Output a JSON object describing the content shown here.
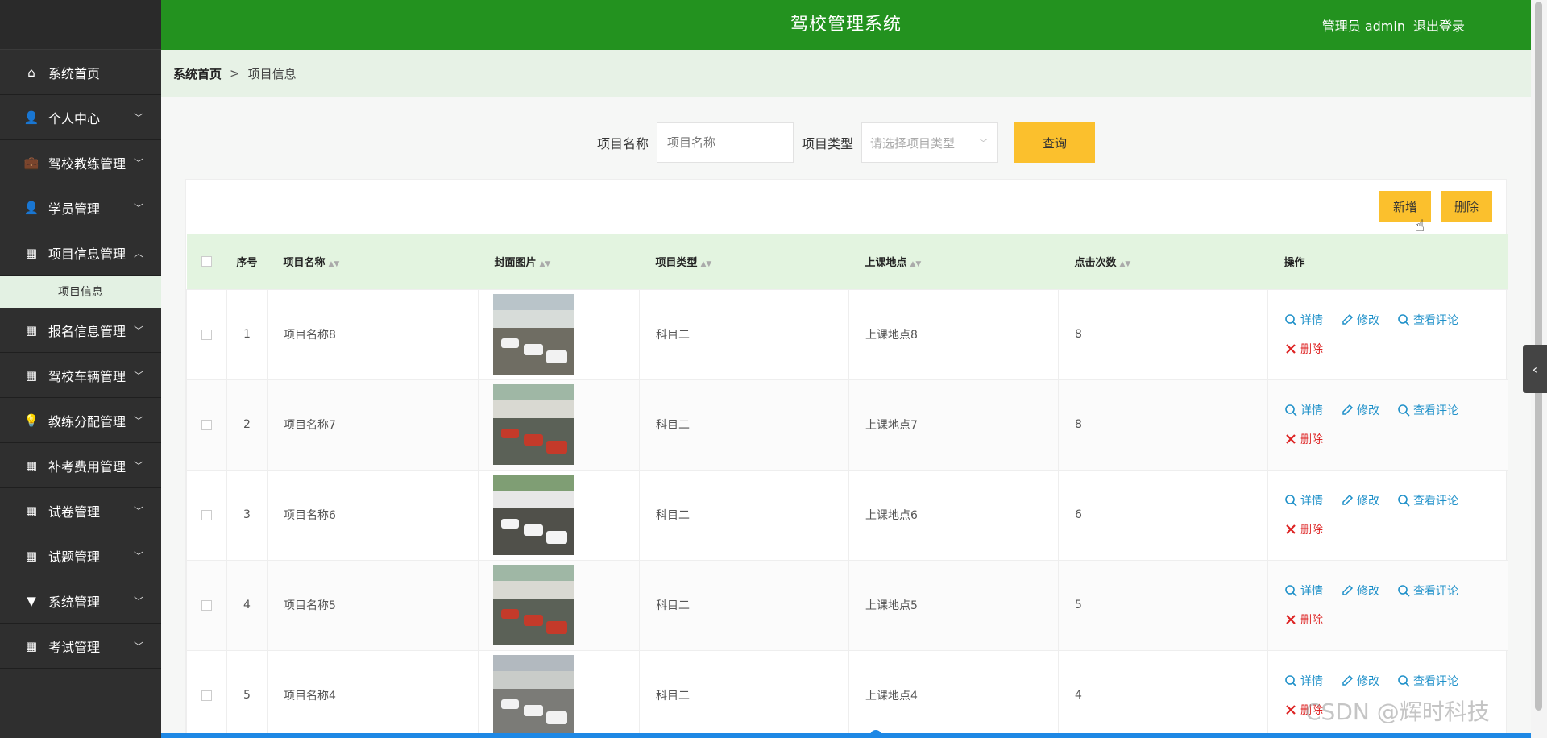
{
  "header": {
    "title": "驾校管理系统",
    "user": "管理员 admin",
    "logout": "退出登录"
  },
  "sidebar": {
    "items": [
      {
        "label": "系统首页",
        "icon": "home-icon",
        "glyph": "⌂",
        "chevron": ""
      },
      {
        "label": "个人中心",
        "icon": "user-icon",
        "glyph": "👤",
        "chevron": "﹀"
      },
      {
        "label": "驾校教练管理",
        "icon": "briefcase-icon",
        "glyph": "💼",
        "chevron": "﹀"
      },
      {
        "label": "学员管理",
        "icon": "user-icon",
        "glyph": "👤",
        "chevron": "﹀"
      },
      {
        "label": "项目信息管理",
        "icon": "grid-icon",
        "glyph": "▦",
        "chevron": "︿"
      },
      {
        "label": "报名信息管理",
        "icon": "grid-icon",
        "glyph": "▦",
        "chevron": "﹀"
      },
      {
        "label": "驾校车辆管理",
        "icon": "grid-icon",
        "glyph": "▦",
        "chevron": "﹀"
      },
      {
        "label": "教练分配管理",
        "icon": "bulb-icon",
        "glyph": "💡",
        "chevron": "﹀"
      },
      {
        "label": "补考费用管理",
        "icon": "grid-icon",
        "glyph": "▦",
        "chevron": "﹀"
      },
      {
        "label": "试卷管理",
        "icon": "grid-icon",
        "glyph": "▦",
        "chevron": "﹀"
      },
      {
        "label": "试题管理",
        "icon": "grid-icon",
        "glyph": "▦",
        "chevron": "﹀"
      },
      {
        "label": "系统管理",
        "icon": "pin-icon",
        "glyph": "▼",
        "chevron": "﹀"
      },
      {
        "label": "考试管理",
        "icon": "grid-icon",
        "glyph": "▦",
        "chevron": "﹀"
      }
    ],
    "submenu": {
      "label": "项目信息"
    }
  },
  "breadcrumb": {
    "home": "系统首页",
    "sep": ">",
    "current": "项目信息"
  },
  "search": {
    "name_label": "项目名称",
    "name_placeholder": "项目名称",
    "type_label": "项目类型",
    "type_placeholder": "请选择项目类型",
    "query_button": "查询"
  },
  "toolbar": {
    "add_label": "新增",
    "delete_label": "删除"
  },
  "table": {
    "columns": {
      "index": "序号",
      "name": "项目名称",
      "image": "封面图片",
      "type": "项目类型",
      "location": "上课地点",
      "clicks": "点击次数",
      "actions": "操作"
    },
    "rows": [
      {
        "index": "1",
        "name": "项目名称8",
        "type": "科目二",
        "location": "上课地点8",
        "clicks": "8"
      },
      {
        "index": "2",
        "name": "项目名称7",
        "type": "科目二",
        "location": "上课地点7",
        "clicks": "8"
      },
      {
        "index": "3",
        "name": "项目名称6",
        "type": "科目二",
        "location": "上课地点6",
        "clicks": "6"
      },
      {
        "index": "4",
        "name": "项目名称5",
        "type": "科目二",
        "location": "上课地点5",
        "clicks": "5"
      },
      {
        "index": "5",
        "name": "项目名称4",
        "type": "科目二",
        "location": "上课地点4",
        "clicks": "4"
      }
    ],
    "actions": {
      "detail": "详情",
      "edit": "修改",
      "comments": "查看评论",
      "delete": "删除"
    }
  },
  "watermark": "CSDN @辉时科技",
  "colors": {
    "header": "#23921f",
    "sidebar": "#2f2f2f",
    "accent_button": "#fbc02d",
    "link": "#1e90c9",
    "danger": "#d22222"
  }
}
